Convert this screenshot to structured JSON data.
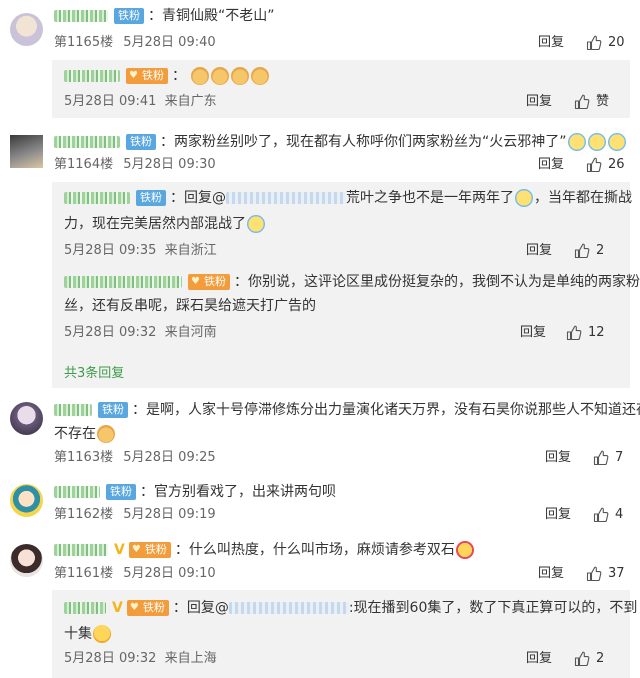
{
  "comments": [
    {
      "badge": "铁粉",
      "text": "青铜仙殿“不老山”",
      "floor": "第1165楼",
      "time": "5月28日 09:40",
      "reply_label": "回复",
      "likes": "20",
      "replies": [
        {
          "badge": "铁粉",
          "emoji_count": 4,
          "time": "5月28日 09:41",
          "location": "来自广东",
          "reply_label": "回复",
          "likes": "赞"
        }
      ]
    },
    {
      "badge": "铁粉",
      "text": "两家粉丝别吵了，现在都有人称呼你们两家粉丝为“火云邪神了”",
      "floor": "第1164楼",
      "time": "5月28日 09:30",
      "reply_label": "回复",
      "likes": "26",
      "replies": [
        {
          "badge": "铁粉",
          "prefix": "回复@",
          "text_line1": "荒叶之争也不是一年两年了",
          "text_line1b": "，当年都在撕战",
          "text_line2": "力，现在完美居然内部混战了",
          "time": "5月28日 09:35",
          "location": "来自浙江",
          "reply_label": "回复",
          "likes": "2"
        },
        {
          "badge": "铁粉",
          "text_line1": "：你别说，这评论区里成份挺复杂的，我倒不认为是单纯的两家粉",
          "text_line2": "丝，还有反串呢，踩石昊给遮天打广告的",
          "time": "5月28日 09:32",
          "location": "来自河南",
          "reply_label": "回复",
          "likes": "12"
        }
      ],
      "more_replies": "共3条回复"
    },
    {
      "badge": "铁粉",
      "text_line1": "：是啊，人家十号停滞修炼分出力量演化诸天万界，没有石昊你说那些人不知道还存",
      "text_line2": "不存在",
      "floor": "第1163楼",
      "time": "5月28日 09:25",
      "reply_label": "回复",
      "likes": "7"
    },
    {
      "badge": "铁粉",
      "text": "官方别看戏了，出来讲两句呗",
      "floor": "第1162楼",
      "time": "5月28日 09:19",
      "reply_label": "回复",
      "likes": "4"
    },
    {
      "badge": "铁粉",
      "text": "什么叫热度，什么叫市场，麻烦请参考双石",
      "floor": "第1161楼",
      "time": "5月28日 09:10",
      "reply_label": "回复",
      "likes": "37",
      "replies": [
        {
          "badge": "铁粉",
          "prefix": "回复@",
          "text_line1": ":现在播到60集了，数了下真正算可以的，不到",
          "text_line2": "十集",
          "time": "5月28日 09:32",
          "location": "来自上海",
          "reply_label": "回复",
          "likes": "2"
        }
      ]
    }
  ],
  "colors": {
    "link_green": "#3f9b4b",
    "fan_blue": "#5aa7e0",
    "fan_orange": "#f39c3b",
    "reply_bg": "#f2f2f2"
  },
  "icons": {
    "like": "thumbs-up-icon",
    "verified": "v-badge-icon"
  }
}
